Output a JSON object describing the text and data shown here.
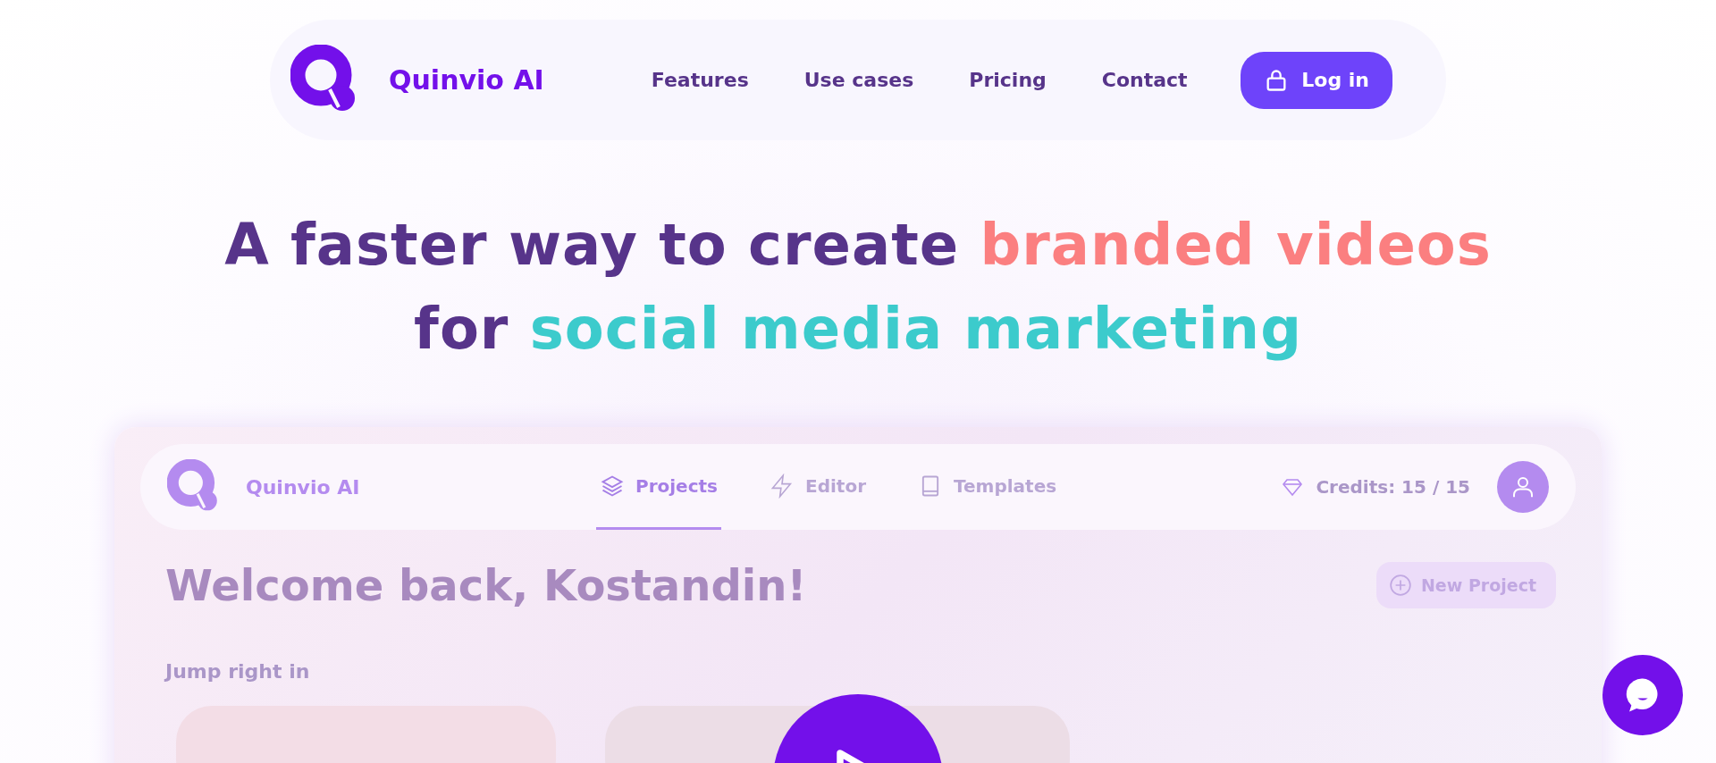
{
  "nav": {
    "brand": "Quinvio AI",
    "links": [
      {
        "label": "Features"
      },
      {
        "label": "Use cases"
      },
      {
        "label": "Pricing"
      },
      {
        "label": "Contact"
      }
    ],
    "login": "Log in"
  },
  "headline": [
    {
      "text": "A faster way to create ",
      "color": "#57348a"
    },
    {
      "text": "branded videos",
      "color": "#fb7f80"
    },
    {
      "text": " for ",
      "color": "#57348a"
    },
    {
      "text": "social media marketing",
      "color": "#3ccbcc"
    }
  ],
  "app": {
    "brand": "Quinvio AI",
    "tabs": [
      {
        "label": "Projects",
        "selected": true
      },
      {
        "label": "Editor",
        "selected": false
      },
      {
        "label": "Templates",
        "selected": false
      }
    ],
    "credits": "Credits: 15 / 15",
    "welcome": "Welcome back, Kostandin!",
    "new_project": "New Project",
    "section": "Jump right in"
  }
}
